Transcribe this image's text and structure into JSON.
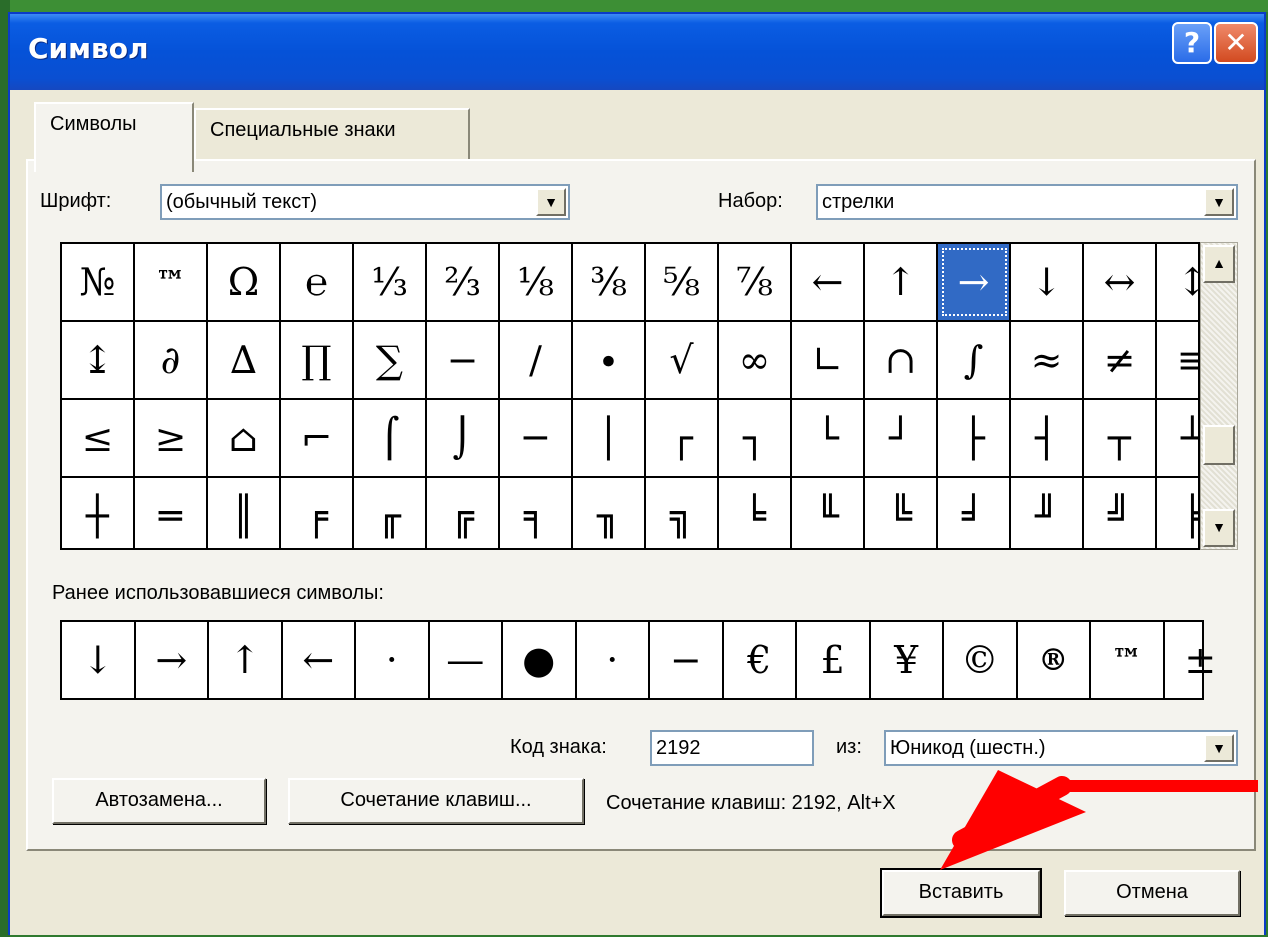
{
  "window": {
    "title": "Символ",
    "help_icon": "?",
    "close_icon": "✕"
  },
  "tabs": [
    {
      "label": "Символы",
      "active": true
    },
    {
      "label": "Специальные знаки",
      "active": false
    }
  ],
  "font": {
    "label": "Шрифт:",
    "value": "(обычный текст)"
  },
  "subset": {
    "label": "Набор:",
    "value": "стрелки"
  },
  "symbol_grid": [
    [
      "№",
      "™",
      "Ω",
      "℮",
      "⅓",
      "⅔",
      "⅛",
      "⅜",
      "⅝",
      "⅞",
      "←",
      "↑",
      "→",
      "↓",
      "↔",
      "↕"
    ],
    [
      "↨",
      "∂",
      "∆",
      "∏",
      "∑",
      "−",
      "∕",
      "∙",
      "√",
      "∞",
      "∟",
      "∩",
      "∫",
      "≈",
      "≠",
      "≡"
    ],
    [
      "≤",
      "≥",
      "⌂",
      "⌐",
      "⌠",
      "⌡",
      "─",
      "│",
      "┌",
      "┐",
      "└",
      "┘",
      "├",
      "┤",
      "┬",
      "┴"
    ],
    [
      "┼",
      "═",
      "║",
      "╒",
      "╓",
      "╔",
      "╕",
      "╖",
      "╗",
      "╘",
      "╙",
      "╚",
      "╛",
      "╜",
      "╝",
      "╞"
    ]
  ],
  "selected_symbol": "→",
  "recent": {
    "label": "Ранее использовавшиеся символы:",
    "symbols": [
      "↓",
      "→",
      "↑",
      "←",
      "·",
      "—",
      "●",
      "·",
      "−",
      "€",
      "£",
      "¥",
      "©",
      "®",
      "™",
      "±"
    ]
  },
  "char_code": {
    "label": "Код знака:",
    "value": "2192"
  },
  "from": {
    "label": "из:",
    "value": "Юникод (шестн.)"
  },
  "shortcut_text": "Сочетание клавиш: 2192, Alt+X",
  "buttons": {
    "autocorrect": "Автозамена...",
    "shortcut_key": "Сочетание клавиш...",
    "insert": "Вставить",
    "cancel": "Отмена"
  },
  "colors": {
    "title_bar": "#0552d8",
    "selection": "#316ac5",
    "annotation_arrow": "#ff0000",
    "background": "#2f7a2f"
  }
}
